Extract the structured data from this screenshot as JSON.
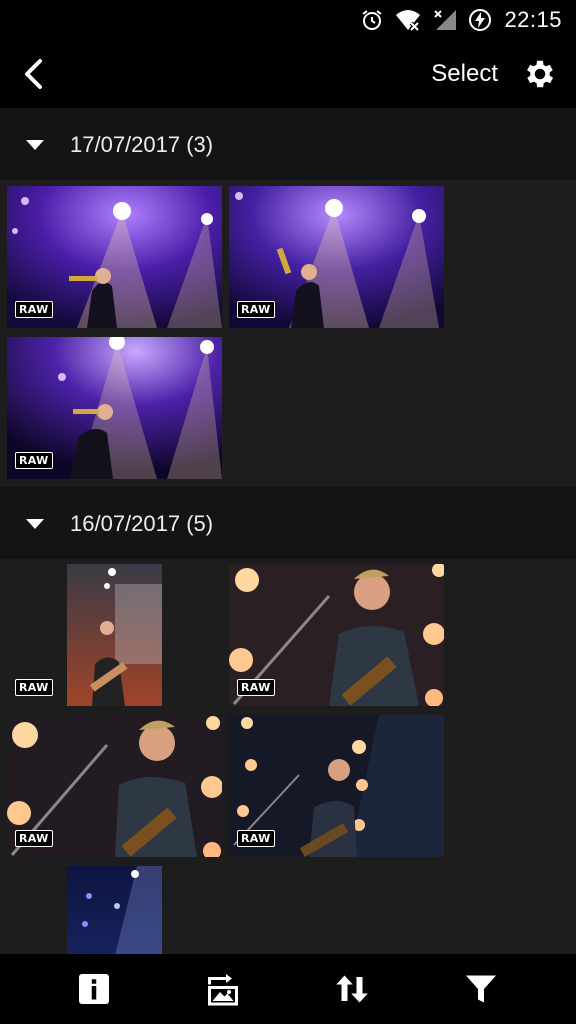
{
  "status": {
    "time": "22:15"
  },
  "app_bar": {
    "select_label": "Select"
  },
  "groups": [
    {
      "label": "17/07/2017 (3)",
      "raw_label": "RAW"
    },
    {
      "label": "16/07/2017 (5)",
      "raw_label": "RAW"
    }
  ],
  "icons": {
    "back": "back-arrow-icon",
    "settings": "gear-icon",
    "info": "info-icon",
    "transfer": "image-transfer-icon",
    "sort": "sort-icon",
    "filter": "filter-icon"
  },
  "colors": {
    "background": "#1d1d1d",
    "header": "#141414",
    "bars": "#000000"
  }
}
